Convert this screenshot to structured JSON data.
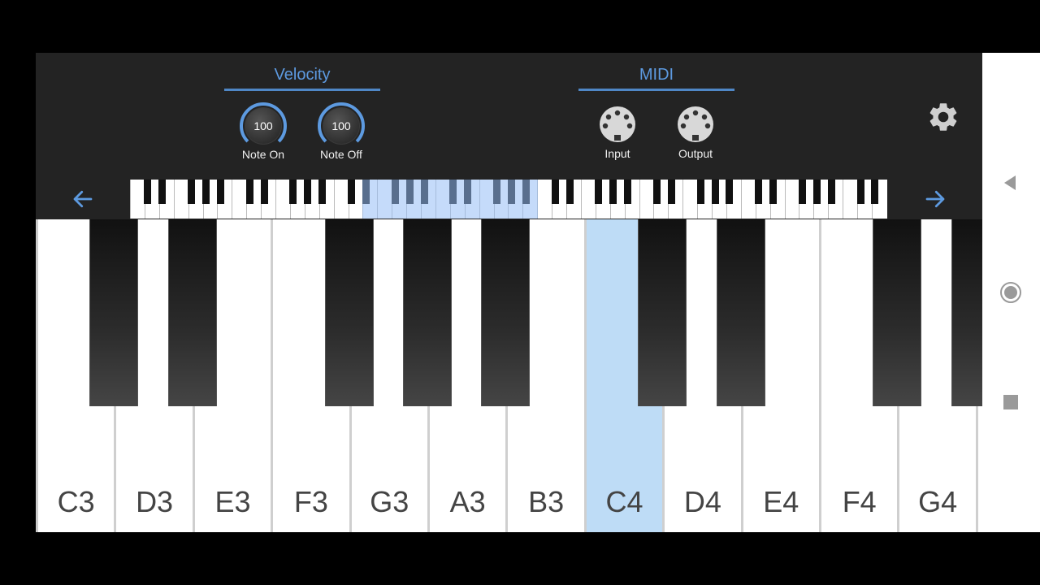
{
  "velocity": {
    "title": "Velocity",
    "note_on": {
      "value": "100",
      "label": "Note On"
    },
    "note_off": {
      "value": "100",
      "label": "Note Off"
    }
  },
  "midi": {
    "title": "MIDI",
    "input": {
      "label": "Input"
    },
    "output": {
      "label": "Output"
    }
  },
  "keyboard": {
    "white_keys": [
      "C3",
      "D3",
      "E3",
      "F3",
      "G3",
      "A3",
      "B3",
      "C4",
      "D4",
      "E4",
      "F4",
      "G4"
    ],
    "active_key": "C4"
  },
  "icons": {
    "settings": "gear-icon",
    "scroll_left": "arrow-left-icon",
    "scroll_right": "arrow-right-icon",
    "midi_port": "midi-din-icon"
  },
  "colors": {
    "accent": "#5d9ae0",
    "active_key": "#bedcf6",
    "background": "#232323"
  }
}
